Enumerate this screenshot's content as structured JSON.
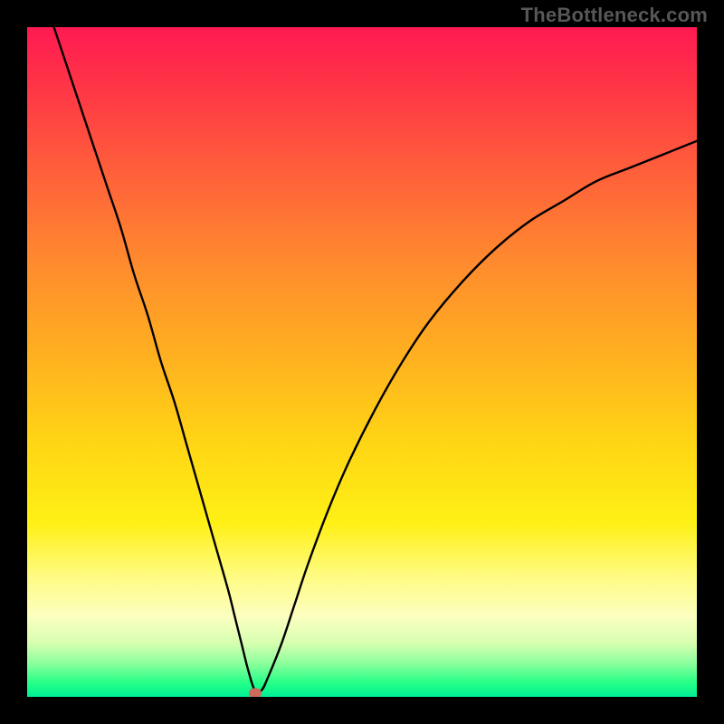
{
  "watermark": "TheBottleneck.com",
  "colors": {
    "frame_bg": "#000000",
    "curve_stroke": "#000000",
    "marker_fill": "#cd6a5a",
    "watermark_text": "#575757"
  },
  "chart_data": {
    "type": "line",
    "title": "",
    "xlabel": "",
    "ylabel": "",
    "xlim": [
      0,
      100
    ],
    "ylim": [
      0,
      100
    ],
    "series": [
      {
        "name": "bottleneck-curve",
        "x": [
          4,
          6,
          8,
          10,
          12,
          14,
          16,
          18,
          20,
          22,
          24,
          26,
          28,
          30,
          31,
          32,
          33,
          34,
          35,
          36,
          38,
          40,
          42,
          45,
          48,
          52,
          56,
          60,
          65,
          70,
          75,
          80,
          85,
          90,
          95,
          100
        ],
        "y": [
          100,
          94,
          88,
          82,
          76,
          70,
          63,
          57,
          50,
          44,
          37,
          30,
          23,
          16,
          12,
          8,
          4,
          1,
          1,
          3,
          8,
          14,
          20,
          28,
          35,
          43,
          50,
          56,
          62,
          67,
          71,
          74,
          77,
          79,
          81,
          83
        ]
      }
    ],
    "marker": {
      "x": 34,
      "y": 0.5
    },
    "background_gradient": [
      "#ff1a52",
      "#ff3247",
      "#ff5a3c",
      "#ff8a2e",
      "#ffb31f",
      "#ffd515",
      "#fff015",
      "#fffb82",
      "#fcffc0",
      "#d6ffb0",
      "#8cff9d",
      "#23ff87",
      "#00ee95"
    ]
  }
}
